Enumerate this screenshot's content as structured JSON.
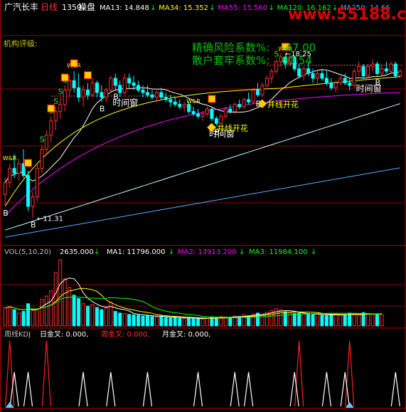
{
  "header": {
    "stock_name": "广汽长丰",
    "period": "日线",
    "title_num": "1350",
    "indicator": "操盘",
    "ma_labels": [
      {
        "text": "MA13: 14.848",
        "arrow": "↓",
        "color": "#ffffff"
      },
      {
        "text": "MA34: 15.352",
        "arrow": "↓",
        "color": "#ffff00"
      },
      {
        "text": "MA55: 15.560",
        "arrow": "↓",
        "color": "#ff00ff"
      },
      {
        "text": "MA120: 16.162",
        "arrow": "↓",
        "color": "#00ff00"
      },
      {
        "text": "MA250: 14.66",
        "arrow": "",
        "color": "#55aaff"
      }
    ]
  },
  "watermark": "www.55188.com",
  "side_label": "机构评级:",
  "info": {
    "risk_label": "精确风险系数%:",
    "risk_value": "-47.00",
    "trap_label": "散户套牢系数%:",
    "trap_value": "60.54"
  },
  "annotations": {
    "high_price": "18.25",
    "low_price": "11.31",
    "shijianchuang": "时间窗",
    "kaihua": "并线开花",
    "buy": "B",
    "sell": "S",
    "wr": "W&R"
  },
  "vol_panel": {
    "title": "VOL(5,10,20)",
    "value": "2635.000",
    "ma1": "MA1: 11796.000",
    "ma2": "MA2: 13913.200",
    "ma3": "MA3: 11984.100",
    "arrow": "↓"
  },
  "kdj_panel": {
    "title": "周线KDJ",
    "d_label": "日金叉: 0.000,",
    "w_label": "周金叉: 0.000,",
    "m_label": "月金叉: 0.000,"
  },
  "colors": {
    "up": "#ff3030",
    "down": "#00ffff",
    "ma13": "#ffffff",
    "ma34": "#ffff00",
    "ma55": "#ff00ff",
    "ma120": "#c8ffff",
    "ma250": "#55aaff",
    "grid": "#8b0000",
    "info_green": "#00c000"
  },
  "chart_data": {
    "type": "candlestick",
    "price": [
      {
        "o": 12.3,
        "h": 13.0,
        "l": 11.8,
        "c": 12.8
      },
      {
        "o": 12.8,
        "h": 13.6,
        "l": 12.6,
        "c": 13.4
      },
      {
        "o": 13.4,
        "h": 14.0,
        "l": 13.0,
        "c": 13.2
      },
      {
        "o": 13.2,
        "h": 13.8,
        "l": 12.9,
        "c": 13.6
      },
      {
        "o": 13.6,
        "h": 14.2,
        "l": 13.0,
        "c": 13.1
      },
      {
        "o": 13.1,
        "h": 13.3,
        "l": 11.6,
        "c": 11.8
      },
      {
        "o": 11.8,
        "h": 12.4,
        "l": 11.31,
        "c": 12.2
      },
      {
        "o": 12.2,
        "h": 13.6,
        "l": 12.0,
        "c": 13.4
      },
      {
        "o": 13.4,
        "h": 14.4,
        "l": 13.2,
        "c": 14.2
      },
      {
        "o": 14.2,
        "h": 15.0,
        "l": 14.0,
        "c": 14.8
      },
      {
        "o": 14.8,
        "h": 15.6,
        "l": 14.5,
        "c": 15.4
      },
      {
        "o": 15.4,
        "h": 16.0,
        "l": 15.0,
        "c": 15.8
      },
      {
        "o": 15.8,
        "h": 16.4,
        "l": 15.5,
        "c": 16.1
      },
      {
        "o": 16.1,
        "h": 16.9,
        "l": 15.8,
        "c": 16.7
      },
      {
        "o": 16.7,
        "h": 17.3,
        "l": 16.4,
        "c": 17.1
      },
      {
        "o": 17.1,
        "h": 17.5,
        "l": 16.6,
        "c": 16.8
      },
      {
        "o": 16.8,
        "h": 17.4,
        "l": 16.2,
        "c": 16.4
      },
      {
        "o": 16.4,
        "h": 16.9,
        "l": 16.0,
        "c": 16.7
      },
      {
        "o": 16.7,
        "h": 17.0,
        "l": 16.3,
        "c": 16.5
      },
      {
        "o": 16.5,
        "h": 17.2,
        "l": 16.4,
        "c": 17.0
      },
      {
        "o": 17.0,
        "h": 17.1,
        "l": 16.4,
        "c": 16.6
      },
      {
        "o": 16.6,
        "h": 16.9,
        "l": 16.2,
        "c": 16.4
      },
      {
        "o": 16.4,
        "h": 16.8,
        "l": 16.2,
        "c": 16.7
      },
      {
        "o": 16.7,
        "h": 17.3,
        "l": 16.6,
        "c": 17.2
      },
      {
        "o": 17.2,
        "h": 17.4,
        "l": 16.7,
        "c": 16.9
      },
      {
        "o": 16.9,
        "h": 17.1,
        "l": 16.4,
        "c": 16.6
      },
      {
        "o": 16.6,
        "h": 17.4,
        "l": 16.5,
        "c": 17.2
      },
      {
        "o": 17.2,
        "h": 17.4,
        "l": 16.8,
        "c": 17.0
      },
      {
        "o": 17.0,
        "h": 17.3,
        "l": 16.7,
        "c": 16.9
      },
      {
        "o": 16.9,
        "h": 17.1,
        "l": 16.6,
        "c": 16.7
      },
      {
        "o": 16.7,
        "h": 16.9,
        "l": 16.4,
        "c": 16.6
      },
      {
        "o": 16.6,
        "h": 16.9,
        "l": 16.4,
        "c": 16.5
      },
      {
        "o": 16.5,
        "h": 16.7,
        "l": 16.3,
        "c": 16.4
      },
      {
        "o": 16.4,
        "h": 16.7,
        "l": 16.2,
        "c": 16.6
      },
      {
        "o": 16.6,
        "h": 16.8,
        "l": 16.3,
        "c": 16.4
      },
      {
        "o": 16.4,
        "h": 16.6,
        "l": 16.2,
        "c": 16.3
      },
      {
        "o": 16.3,
        "h": 16.5,
        "l": 16.0,
        "c": 16.2
      },
      {
        "o": 16.2,
        "h": 16.4,
        "l": 16.0,
        "c": 16.1
      },
      {
        "o": 16.1,
        "h": 16.3,
        "l": 15.9,
        "c": 16.0
      },
      {
        "o": 16.0,
        "h": 16.2,
        "l": 15.8,
        "c": 16.1
      },
      {
        "o": 16.1,
        "h": 16.2,
        "l": 15.7,
        "c": 15.8
      },
      {
        "o": 15.8,
        "h": 16.0,
        "l": 15.6,
        "c": 15.7
      },
      {
        "o": 15.7,
        "h": 15.9,
        "l": 15.5,
        "c": 15.6
      },
      {
        "o": 15.6,
        "h": 15.8,
        "l": 15.4,
        "c": 15.7
      },
      {
        "o": 15.7,
        "h": 16.0,
        "l": 15.6,
        "c": 15.9
      },
      {
        "o": 15.9,
        "h": 16.0,
        "l": 15.4,
        "c": 15.5
      },
      {
        "o": 15.5,
        "h": 15.6,
        "l": 15.2,
        "c": 15.3
      },
      {
        "o": 15.3,
        "h": 15.7,
        "l": 15.2,
        "c": 15.6
      },
      {
        "o": 15.6,
        "h": 16.0,
        "l": 15.5,
        "c": 15.9
      },
      {
        "o": 15.9,
        "h": 16.1,
        "l": 15.7,
        "c": 15.8
      },
      {
        "o": 15.8,
        "h": 16.2,
        "l": 15.7,
        "c": 16.1
      },
      {
        "o": 16.1,
        "h": 16.3,
        "l": 15.9,
        "c": 16.0
      },
      {
        "o": 16.0,
        "h": 16.4,
        "l": 15.9,
        "c": 16.3
      },
      {
        "o": 16.3,
        "h": 16.6,
        "l": 16.1,
        "c": 16.2
      },
      {
        "o": 16.2,
        "h": 16.8,
        "l": 16.1,
        "c": 16.7
      },
      {
        "o": 16.7,
        "h": 17.0,
        "l": 16.4,
        "c": 16.5
      },
      {
        "o": 16.5,
        "h": 17.0,
        "l": 16.4,
        "c": 16.9
      },
      {
        "o": 16.9,
        "h": 17.3,
        "l": 16.8,
        "c": 17.2
      },
      {
        "o": 17.2,
        "h": 17.6,
        "l": 17.0,
        "c": 17.5
      },
      {
        "o": 17.5,
        "h": 18.0,
        "l": 17.4,
        "c": 17.9
      },
      {
        "o": 17.9,
        "h": 18.25,
        "l": 17.7,
        "c": 18.1
      },
      {
        "o": 18.1,
        "h": 18.2,
        "l": 17.6,
        "c": 17.8
      },
      {
        "o": 17.8,
        "h": 18.2,
        "l": 17.7,
        "c": 18.1
      },
      {
        "o": 18.1,
        "h": 18.15,
        "l": 17.5,
        "c": 17.6
      },
      {
        "o": 17.6,
        "h": 17.8,
        "l": 17.2,
        "c": 17.3
      },
      {
        "o": 17.3,
        "h": 17.7,
        "l": 17.1,
        "c": 17.6
      },
      {
        "o": 17.6,
        "h": 17.9,
        "l": 17.3,
        "c": 17.4
      },
      {
        "o": 17.4,
        "h": 17.6,
        "l": 17.0,
        "c": 17.2
      },
      {
        "o": 17.2,
        "h": 17.5,
        "l": 17.0,
        "c": 17.4
      },
      {
        "o": 17.4,
        "h": 17.6,
        "l": 17.1,
        "c": 17.2
      },
      {
        "o": 17.2,
        "h": 17.5,
        "l": 16.9,
        "c": 17.0
      },
      {
        "o": 17.0,
        "h": 17.2,
        "l": 16.7,
        "c": 16.8
      },
      {
        "o": 16.8,
        "h": 17.1,
        "l": 16.6,
        "c": 17.0
      },
      {
        "o": 17.0,
        "h": 17.3,
        "l": 16.9,
        "c": 17.2
      },
      {
        "o": 17.2,
        "h": 17.4,
        "l": 16.9,
        "c": 17.0
      },
      {
        "o": 17.0,
        "h": 17.2,
        "l": 16.7,
        "c": 16.9
      },
      {
        "o": 16.9,
        "h": 17.6,
        "l": 16.8,
        "c": 17.5
      },
      {
        "o": 17.5,
        "h": 17.9,
        "l": 17.3,
        "c": 17.7
      },
      {
        "o": 17.7,
        "h": 17.8,
        "l": 17.2,
        "c": 17.3
      },
      {
        "o": 17.3,
        "h": 17.8,
        "l": 17.2,
        "c": 17.7
      },
      {
        "o": 17.7,
        "h": 18.0,
        "l": 17.5,
        "c": 17.8
      },
      {
        "o": 17.8,
        "h": 17.9,
        "l": 17.3,
        "c": 17.4
      },
      {
        "o": 17.4,
        "h": 17.8,
        "l": 17.3,
        "c": 17.6
      },
      {
        "o": 17.6,
        "h": 17.9,
        "l": 17.4,
        "c": 17.5
      },
      {
        "o": 17.5,
        "h": 17.9,
        "l": 17.4,
        "c": 17.8
      },
      {
        "o": 17.8,
        "h": 17.9,
        "l": 17.2,
        "c": 17.3
      },
      {
        "o": 17.3,
        "h": 17.6,
        "l": 17.2,
        "c": 17.5
      }
    ],
    "markers": {
      "sell_idx": [
        8,
        10,
        11,
        12,
        13,
        59
      ],
      "wr_idx": [
        1,
        15,
        41,
        61
      ],
      "buy_idx": [
        0,
        6,
        21,
        24,
        46,
        55,
        81
      ],
      "shijianchuang_idx": [
        24,
        45,
        77
      ],
      "kaihua_idx": [
        45,
        56
      ]
    },
    "volume": [
      4200,
      4600,
      3800,
      3000,
      3400,
      5200,
      3600,
      3900,
      6200,
      7000,
      8200,
      12500,
      15500,
      11000,
      9000,
      7200,
      6400,
      5200,
      4600,
      5000,
      4300,
      3800,
      4200,
      5500,
      3400,
      3000,
      2900,
      2700,
      2600,
      2500,
      2300,
      2400,
      2200,
      2100,
      2300,
      2000,
      1900,
      2100,
      1800,
      1700,
      1900,
      1800,
      1700,
      1600,
      1800,
      2000,
      1900,
      2200,
      2100,
      2000,
      2300,
      2200,
      2600,
      2400,
      2800,
      3000,
      2700,
      3200,
      3600,
      4000,
      3800,
      3300,
      3100,
      2900,
      3000,
      2800,
      2700,
      2600,
      2900,
      2500,
      2400,
      2600,
      2800,
      2500,
      2700,
      3000,
      2800,
      2600,
      3100,
      2900,
      2700,
      2800,
      2635
    ],
    "volume_range": [
      0,
      16000
    ],
    "price_range": [
      10.3,
      19.6
    ],
    "kdj_spikes": {
      "white_idx": [
        2,
        5,
        17,
        23,
        31,
        42,
        50,
        53,
        63,
        70,
        74,
        85
      ],
      "red_idx": [
        1,
        9,
        64,
        75
      ]
    }
  }
}
